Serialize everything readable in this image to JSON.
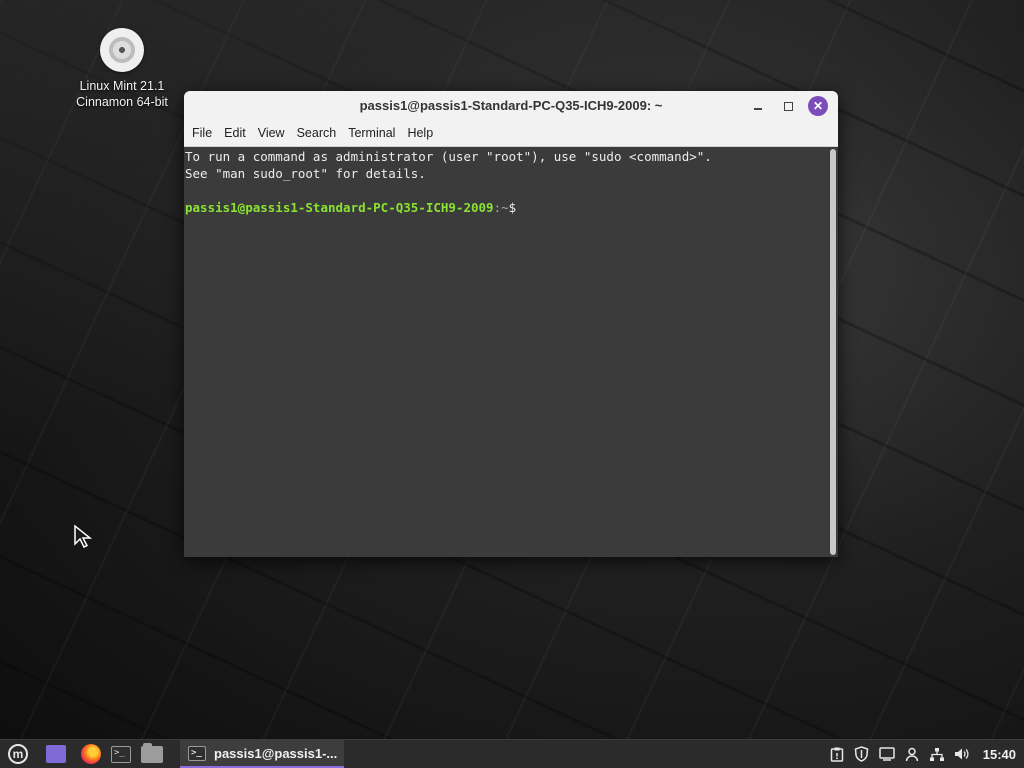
{
  "desktop": {
    "icon_label_line1": "Linux Mint 21.1",
    "icon_label_line2": "Cinnamon 64-bit"
  },
  "window": {
    "title": "passis1@passis1-Standard-PC-Q35-ICH9-2009: ~",
    "menu": [
      "File",
      "Edit",
      "View",
      "Search",
      "Terminal",
      "Help"
    ]
  },
  "terminal": {
    "line1": "To run a command as administrator (user \"root\"), use \"sudo <command>\".",
    "line2": "See \"man sudo_root\" for details.",
    "prompt_user": "passis1@passis1-Standard-PC-Q35-ICH9-2009",
    "prompt_path": ":~",
    "prompt_symbol": "$"
  },
  "taskbar": {
    "task_label": "passis1@passis1-...",
    "clock": "15:40"
  },
  "colors": {
    "accent": "#7c4dba",
    "prompt_green": "#8ae234"
  }
}
